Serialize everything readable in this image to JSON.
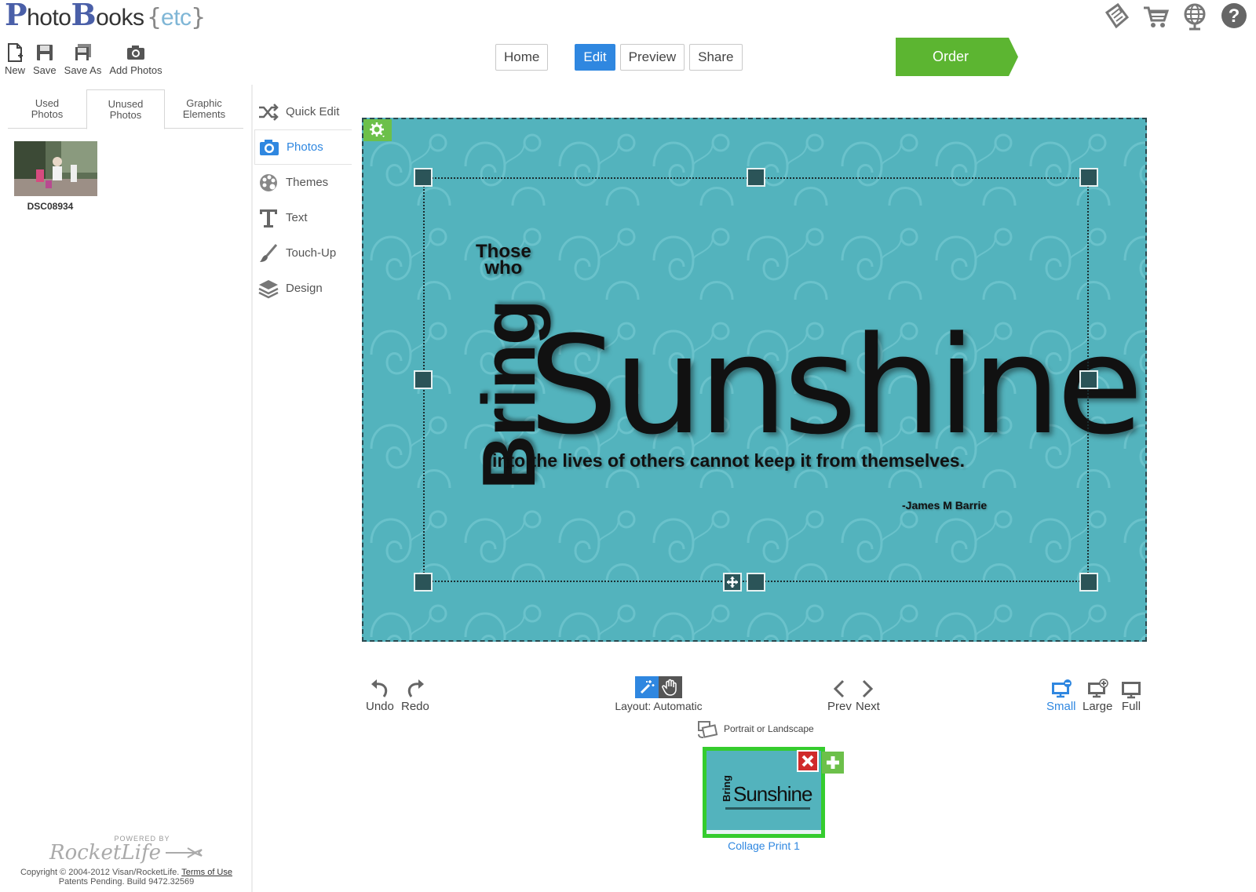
{
  "logo": {
    "p": "P",
    "hoto": "hoto",
    "b": "B",
    "ooks": "ooks",
    "brace_open": "{",
    "etc": "etc",
    "brace_close": "}"
  },
  "file_toolbar": {
    "new": "New",
    "save": "Save",
    "save_as": "Save As",
    "add_photos": "Add Photos"
  },
  "nav": {
    "home": "Home",
    "edit": "Edit",
    "preview": "Preview",
    "share": "Share",
    "active": "Edit"
  },
  "order": {
    "label": "Order",
    "color": "#5cb531"
  },
  "top_icons": [
    "coupon-icon",
    "cart-icon",
    "globe-icon",
    "help-icon"
  ],
  "left_tabs": [
    {
      "label": "Used\nPhotos"
    },
    {
      "label": "Unused\nPhotos",
      "active": true
    },
    {
      "label": "Graphic\nElements"
    }
  ],
  "photos": [
    {
      "name": "DSC08934"
    }
  ],
  "tools": [
    {
      "label": "Quick Edit",
      "icon": "shuffle-icon"
    },
    {
      "label": "Photos",
      "icon": "camera-icon",
      "active": true
    },
    {
      "label": "Themes",
      "icon": "palette-icon"
    },
    {
      "label": "Text",
      "icon": "text-icon"
    },
    {
      "label": "Touch-Up",
      "icon": "brush-icon"
    },
    {
      "label": "Design",
      "icon": "layers-icon"
    }
  ],
  "canvas": {
    "background": "#53b3bd",
    "quote": {
      "those_who_1": "Those",
      "those_who_2": "who",
      "bring": "Bring",
      "sunshine": "Sunshine",
      "rest": "into the lives of others cannot keep it from themselves.",
      "author": "-James M Barrie"
    }
  },
  "controls": {
    "undo": "Undo",
    "redo": "Redo",
    "layout": "Layout: Automatic",
    "prev": "Prev",
    "next": "Next",
    "small": "Small",
    "large": "Large",
    "full": "Full",
    "orientation": "Portrait or Landscape"
  },
  "pages": [
    {
      "label": "Collage Print 1",
      "selected": true
    }
  ],
  "footer": {
    "powered_by": "POWERED BY",
    "brand": "RocketLife",
    "copyright": "Copyright © 2004-2012 Visan/RocketLife.",
    "terms": "Terms of Use",
    "patents": "Patents Pending. Build 9472.32569"
  },
  "accent_colors": {
    "blue": "#2f87e0",
    "green": "#5cb531",
    "selected_border": "#35cc2e",
    "delete_red": "#d02a2a"
  }
}
